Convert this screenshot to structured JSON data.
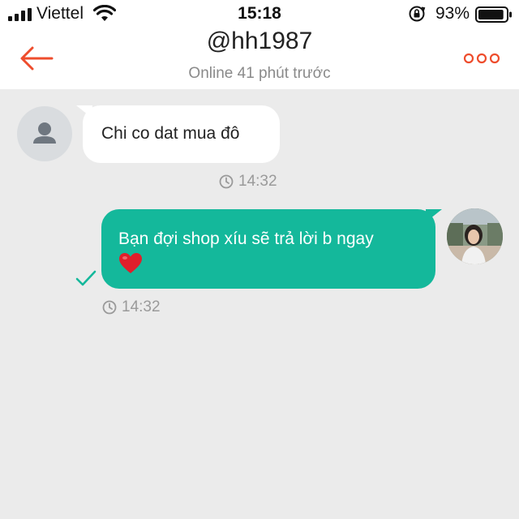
{
  "status_bar": {
    "carrier": "Viettel",
    "time": "15:18",
    "battery": "93%",
    "battery_level": 0.93
  },
  "header": {
    "title": "@hh1987",
    "subtitle": "Online 41 phút trước",
    "back_icon": "back-arrow-icon",
    "more_icon": "more-dots-icon",
    "accent_color": "#ee4d2d"
  },
  "messages": [
    {
      "direction": "incoming",
      "text": "Chi co dat mua đô",
      "time": "14:32"
    },
    {
      "direction": "outgoing",
      "text": "Bạn đợi shop xíu sẽ trả lời b ngay",
      "emoji": "heart",
      "time": "14:32",
      "status": "sent"
    }
  ],
  "colors": {
    "outgoing_bubble": "#14b89b",
    "incoming_bubble": "#ffffff",
    "background": "#ebebeb"
  }
}
